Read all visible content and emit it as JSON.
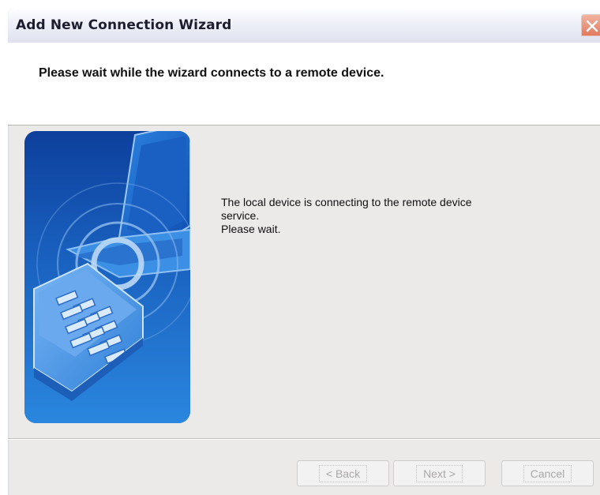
{
  "window": {
    "title": "Add New Connection Wizard",
    "close_icon": "close-icon"
  },
  "header": {
    "heading": "Please wait while the wizard connects to a remote device."
  },
  "content": {
    "illustration_icon": "bluetooth-phone-laptop-illustration",
    "line1": "The local device is connecting to the remote device",
    "line2": "service.",
    "line3": "Please wait."
  },
  "buttons": {
    "back": {
      "label": "< Back",
      "enabled": false
    },
    "next": {
      "label": "Next >",
      "enabled": false
    },
    "cancel": {
      "label": "Cancel",
      "enabled": false
    }
  },
  "colors": {
    "illustration_blue": "#1f6cc4",
    "close_button": "#e27a5e",
    "dialog_background": "#ece9e9"
  }
}
